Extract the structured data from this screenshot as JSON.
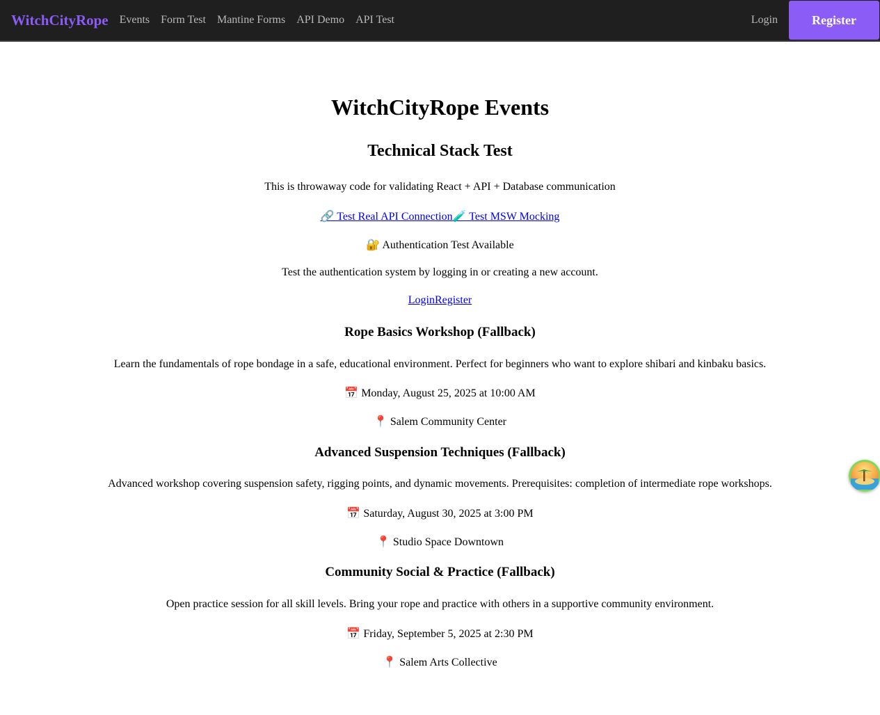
{
  "nav": {
    "brand": "WitchCityRope",
    "links": [
      "Events",
      "Form Test",
      "Mantine Forms",
      "API Demo",
      "API Test"
    ],
    "login": "Login",
    "register": "Register"
  },
  "main": {
    "title": "WitchCityRope Events",
    "subtitle": "Technical Stack Test",
    "description": "This is throwaway code for validating React + API + Database communication",
    "test_links": [
      "🔗 Test Real API Connection",
      "🧪 Test MSW Mocking"
    ],
    "auth_notice": "🔐 Authentication Test Available",
    "auth_description": "Test the authentication system by logging in or creating a new account.",
    "auth_links": [
      "Login",
      "Register"
    ]
  },
  "events": [
    {
      "title": "Rope Basics Workshop (Fallback)",
      "description": "Learn the fundamentals of rope bondage in a safe, educational environment. Perfect for beginners who want to explore shibari and kinbaku basics.",
      "date": "📅 Monday, August 25, 2025 at 10:00 AM",
      "location": "📍 Salem Community Center"
    },
    {
      "title": "Advanced Suspension Techniques (Fallback)",
      "description": "Advanced workshop covering suspension safety, rigging points, and dynamic movements. Prerequisites: completion of intermediate rope workshops.",
      "date": "📅 Saturday, August 30, 2025 at 3:00 PM",
      "location": "📍 Studio Space Downtown"
    },
    {
      "title": "Community Social & Practice (Fallback)",
      "description": "Open practice session for all skill levels. Bring your rope and practice with others in a supportive community environment.",
      "date": "📅 Friday, September 5, 2025 at 2:30 PM",
      "location": "📍 Salem Arts Collective"
    }
  ],
  "colors": {
    "accent": "#8b5cf6",
    "nav_bg": "#1f1f1f",
    "link": "#0000ee"
  },
  "icons": {
    "floating_button": "island-icon"
  }
}
